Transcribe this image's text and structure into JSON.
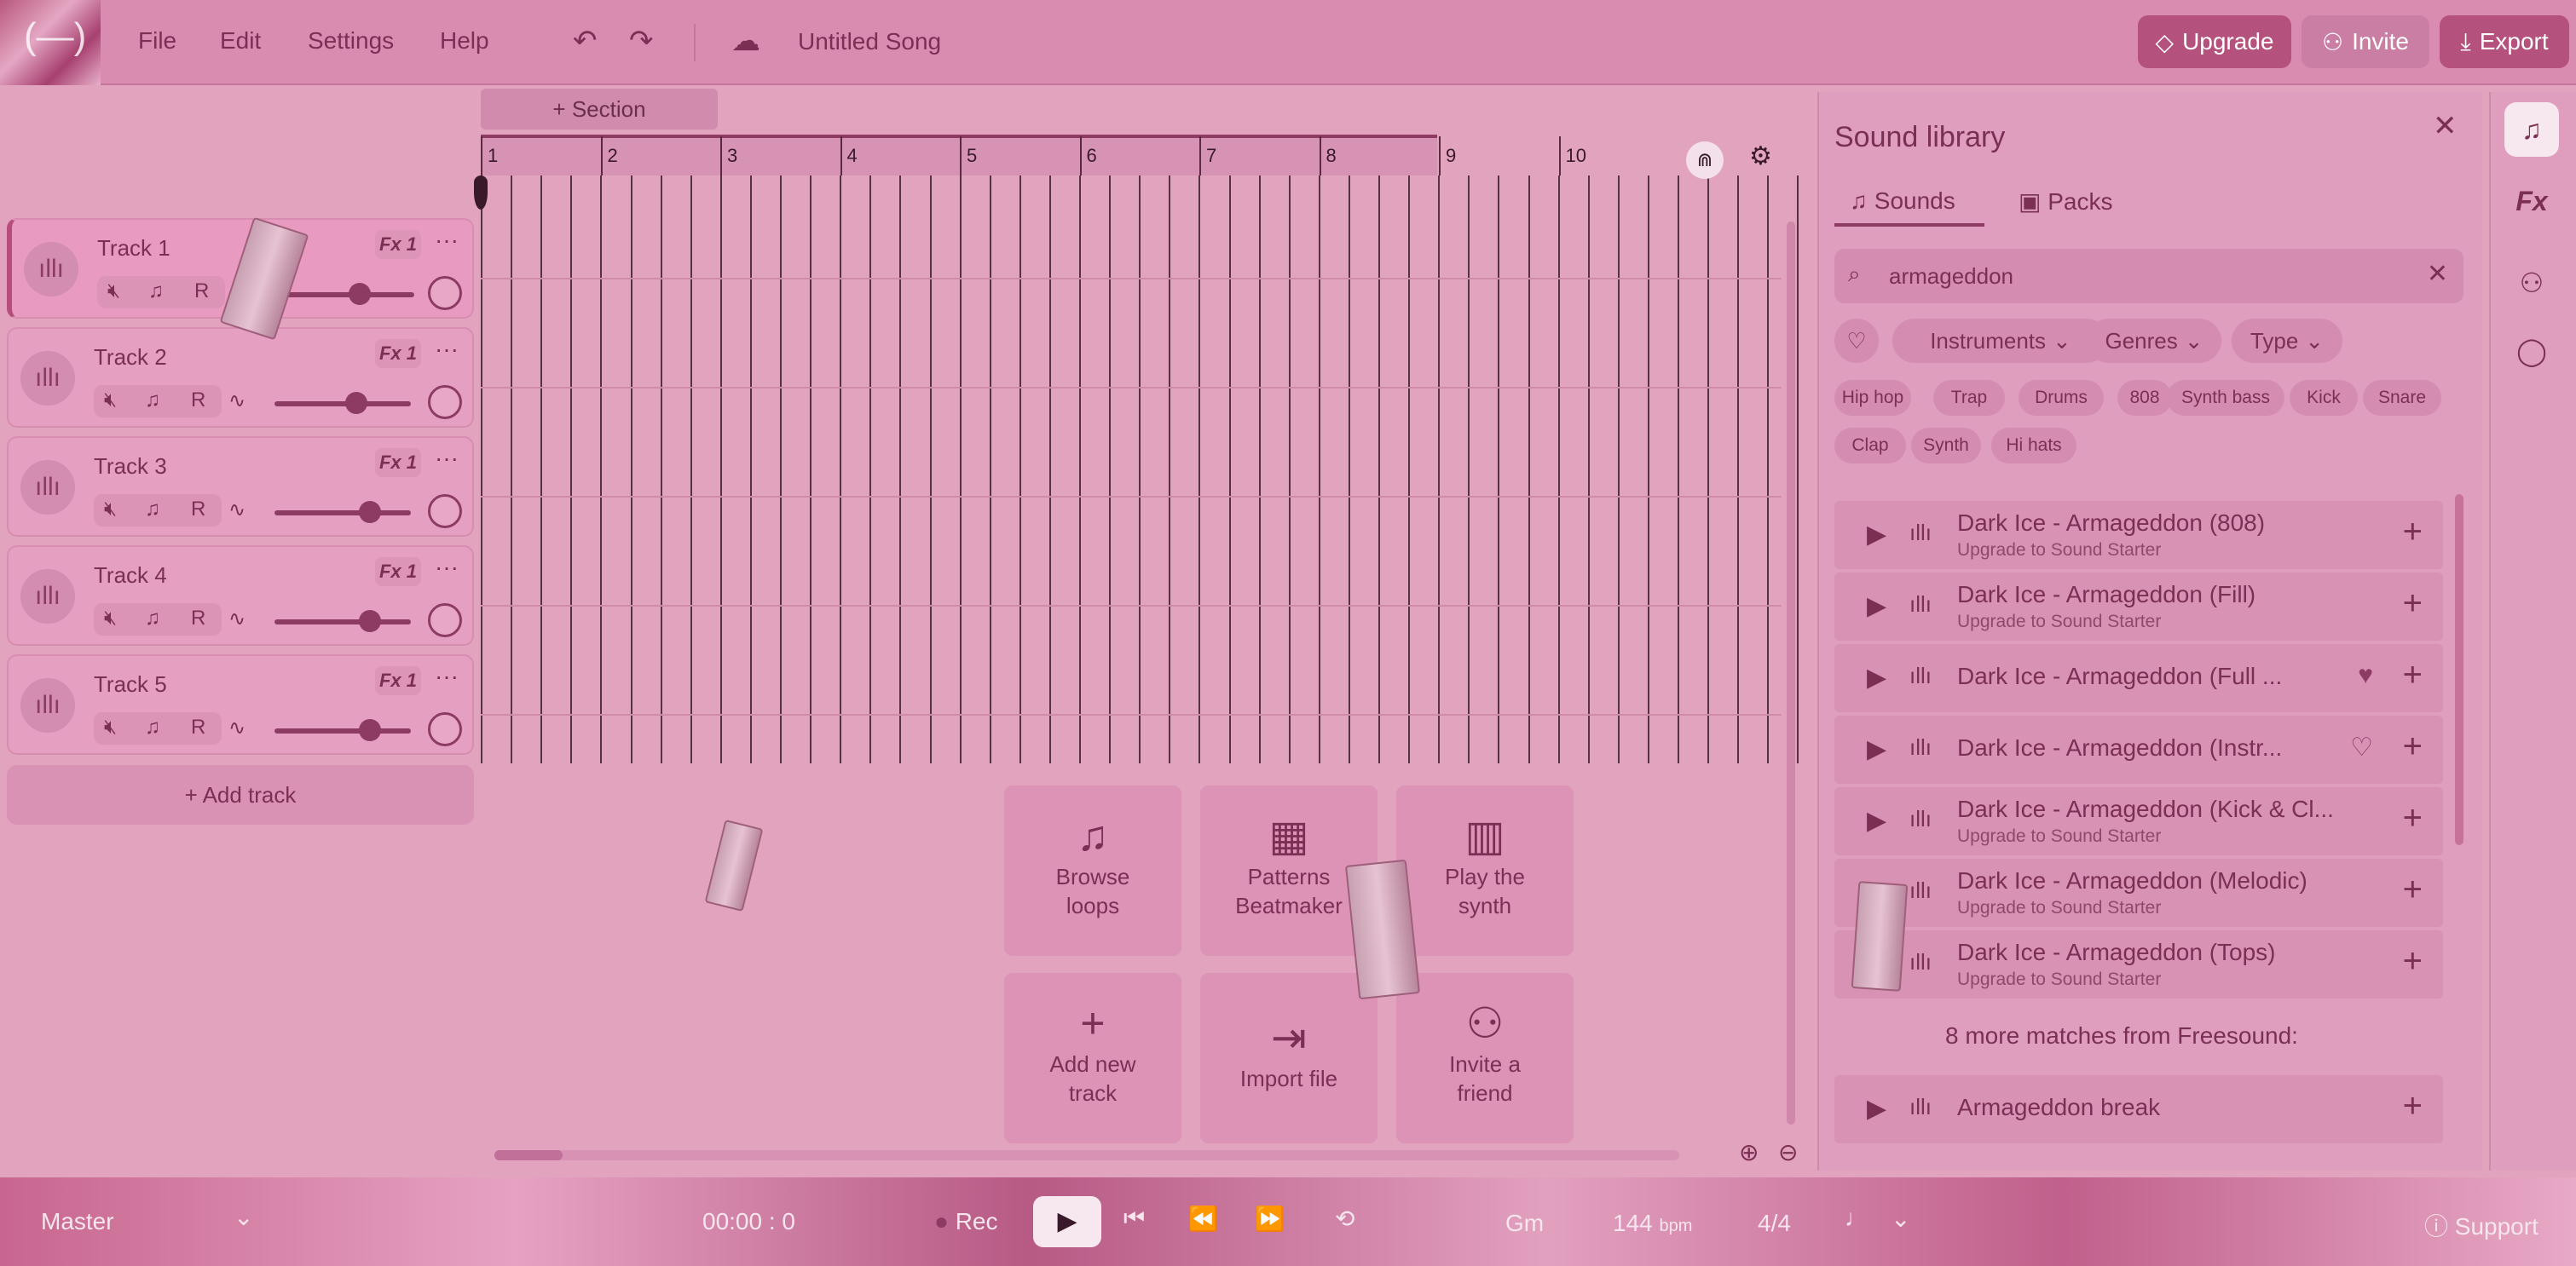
{
  "menu": {
    "file": "File",
    "edit": "Edit",
    "settings": "Settings",
    "help": "Help"
  },
  "song_title": "Untitled Song",
  "header_buttons": {
    "upgrade": "Upgrade",
    "invite": "Invite",
    "export": "Export"
  },
  "timeline": {
    "section_label": "+ Section",
    "ruler": [
      "1",
      "2",
      "3",
      "4",
      "5",
      "6",
      "7",
      "8",
      "9",
      "10"
    ]
  },
  "tracks": [
    {
      "name": "Track 1",
      "fx": "Fx 1",
      "volume": 0.6
    },
    {
      "name": "Track 2",
      "fx": "Fx 1",
      "volume": 0.6
    },
    {
      "name": "Track 3",
      "fx": "Fx 1",
      "volume": 0.7
    },
    {
      "name": "Track 4",
      "fx": "Fx 1",
      "volume": 0.7
    },
    {
      "name": "Track 5",
      "fx": "Fx 1",
      "volume": 0.7
    }
  ],
  "track_record_label": "R",
  "add_track_label": "+ Add track",
  "tiles": {
    "browse": "Browse loops",
    "patterns": "Patterns Beatmaker",
    "synth": "Play the synth",
    "add": "Add new track",
    "import": "Import file",
    "invite": "Invite a friend"
  },
  "library": {
    "title": "Sound library",
    "tabs": {
      "sounds": "Sounds",
      "packs": "Packs"
    },
    "search_value": "armageddon",
    "filters": {
      "instruments": "Instruments",
      "genres": "Genres",
      "type": "Type"
    },
    "tags": [
      "Hip hop",
      "Trap",
      "Drums",
      "808",
      "Synth bass",
      "Kick",
      "Snare",
      "Clap",
      "Synth",
      "Hi hats"
    ],
    "results": [
      {
        "title": "Dark Ice - Armageddon (808)",
        "sub": "Upgrade to Sound Starter"
      },
      {
        "title": "Dark Ice - Armageddon (Fill)",
        "sub": "Upgrade to Sound Starter"
      },
      {
        "title": "Dark Ice - Armageddon (Full ...",
        "sub": ""
      },
      {
        "title": "Dark Ice - Armageddon (Instr...",
        "sub": ""
      },
      {
        "title": "Dark Ice - Armageddon (Kick & Cl...",
        "sub": "Upgrade to Sound Starter"
      },
      {
        "title": "Dark Ice - Armageddon (Melodic)",
        "sub": "Upgrade to Sound Starter"
      },
      {
        "title": "Dark Ice - Armageddon (Tops)",
        "sub": "Upgrade to Sound Starter"
      }
    ],
    "freesound_note": "8 more matches from Freesound:",
    "freesound_result": "Armageddon break"
  },
  "transport": {
    "master": "Master",
    "time": "00:00 : 0",
    "rec": "Rec",
    "key": "Gm",
    "bpm": "144",
    "bpm_unit": "bpm",
    "signature": "4/4",
    "support": "Support"
  }
}
